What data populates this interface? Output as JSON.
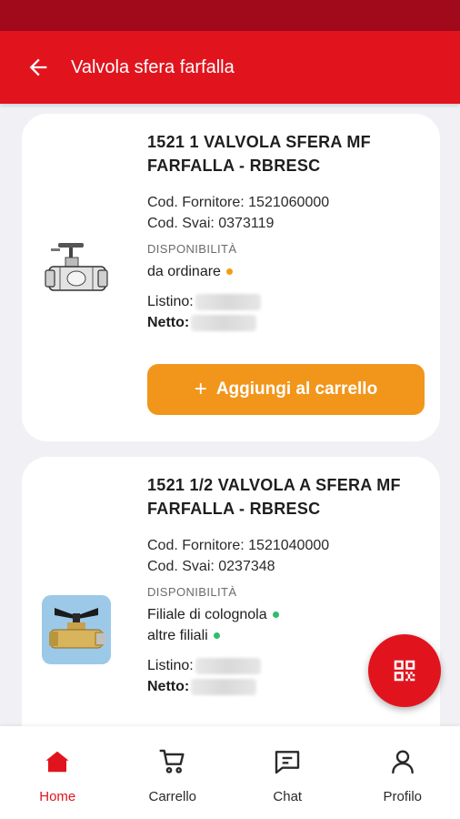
{
  "header": {
    "title": "Valvola sfera farfalla",
    "back_icon": "arrow-left-icon"
  },
  "products": [
    {
      "title": "1521 1 VALVOLA SFERA MF FARFALLA - RBRESC",
      "supplier_code": "Cod. Fornitore: 1521060000",
      "svai_code": "Cod. Svai: 0373119",
      "availability_label": "DISPONIBILITÀ",
      "availability": [
        {
          "text": "da ordinare",
          "status_color": "#f39c12"
        }
      ],
      "list_price_label": "Listino:",
      "net_price_label": "Netto:",
      "add_to_cart_label": "Aggiungi al carrello"
    },
    {
      "title": "1521 1/2 VALVOLA A SFERA MF FARFALLA - RBRESC",
      "supplier_code": "Cod. Fornitore: 1521040000",
      "svai_code": "Cod. Svai: 0237348",
      "availability_label": "DISPONIBILITÀ",
      "availability": [
        {
          "text": "Filiale di colognola",
          "status_color": "#2ebd6b"
        },
        {
          "text": "altre filiali",
          "status_color": "#2ebd6b"
        }
      ],
      "list_price_label": "Listino:",
      "net_price_label": "Netto:"
    }
  ],
  "fab": {
    "icon": "qr-code-icon"
  },
  "bottom_nav": [
    {
      "label": "Home",
      "icon": "home-icon",
      "active": true
    },
    {
      "label": "Carrello",
      "icon": "cart-icon",
      "active": false
    },
    {
      "label": "Chat",
      "icon": "chat-icon",
      "active": false
    },
    {
      "label": "Profilo",
      "icon": "profile-icon",
      "active": false
    }
  ],
  "colors": {
    "primary": "#e1141e",
    "status_bar": "#a10a1b",
    "accent_button": "#f2961b",
    "background": "#f1f1f5"
  }
}
